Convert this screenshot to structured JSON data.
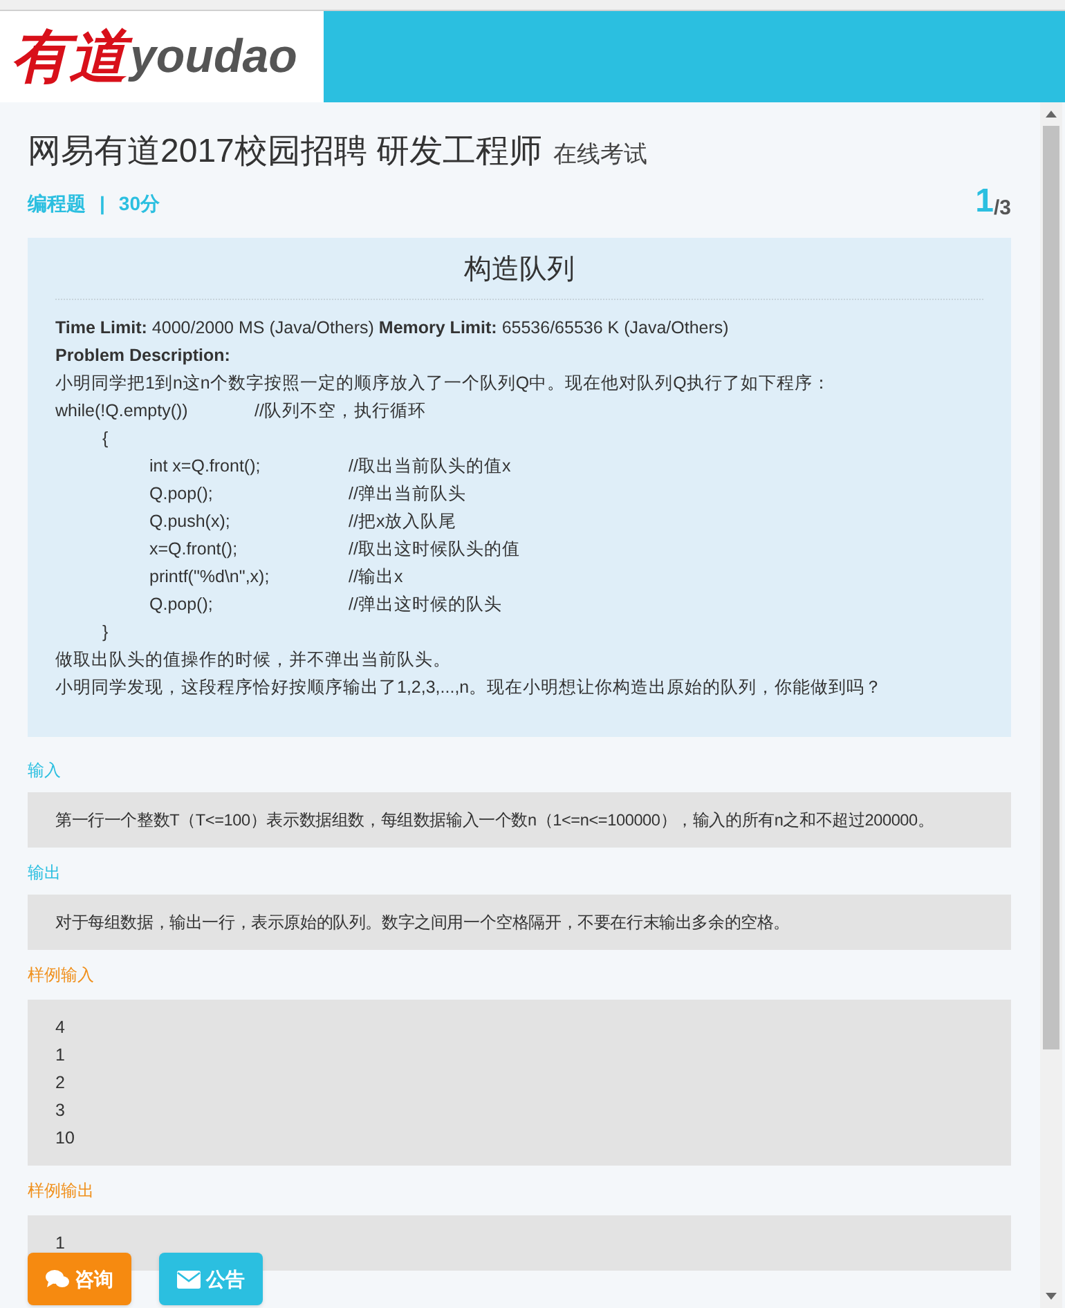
{
  "header": {
    "logo_cn": "有道",
    "logo_en": "youdao"
  },
  "exam": {
    "title": "网易有道2017校园招聘 研发工程师",
    "subtitle": "在线考试",
    "type": "编程题",
    "separator": "|",
    "score": "30分",
    "current": "1",
    "total": "/3"
  },
  "problem": {
    "title": "构造队列",
    "limits": "**Time Limit:** 4000/2000 MS (Java/Others) **Memory Limit:** 65536/65536 K (Java/Others)",
    "description_label": "Problem Description:",
    "lines": [
      {
        "kind": "text",
        "text": "小明同学把1到n这n个数字按照一定的顺序放入了一个队列Q中。现在他对队列Q执行了如下程序："
      },
      {
        "kind": "code",
        "code": "while(!Q.empty())",
        "comment": "//队列不空，执行循环",
        "children": [
          {
            "kind": "code",
            "code": "{",
            "children": [
              {
                "kind": "code",
                "code": "int x=Q.front();",
                "comment": "//取出当前队头的值x"
              },
              {
                "kind": "code",
                "code": "Q.pop();",
                "comment": "//弹出当前队头"
              },
              {
                "kind": "code",
                "code": "Q.push(x);",
                "comment": "//把x放入队尾"
              },
              {
                "kind": "code",
                "code": "x=Q.front();",
                "comment": "//取出这时候队头的值"
              },
              {
                "kind": "code",
                "code": "printf(\"%d\\n\",x);",
                "comment": "//输出x"
              },
              {
                "kind": "code",
                "code": "Q.pop();",
                "comment": "//弹出这时候的队头"
              }
            ]
          },
          {
            "kind": "code",
            "code": "}"
          }
        ]
      },
      {
        "kind": "text",
        "text": "做取出队头的值操作的时候，并不弹出当前队头。"
      },
      {
        "kind": "text",
        "text": "小明同学发现，这段程序恰好按顺序输出了1,2,3,...,n。现在小明想让你构造出原始的队列，你能做到吗？"
      }
    ]
  },
  "sections": [
    {
      "kind": "info",
      "label": "输入",
      "lines": [
        "第一行一个整数T（T<=100）表示数据组数，每组数据输入一个数n（1<=n<=100000），输入的所有n之和不超过200000。"
      ]
    },
    {
      "kind": "info",
      "label": "输出",
      "lines": [
        "对于每组数据，输出一行，表示原始的队列。数字之间用一个空格隔开，不要在行末输出多余的空格。"
      ]
    },
    {
      "kind": "sample",
      "label": "样例输入",
      "lines": [
        "4",
        "1",
        "2",
        "3",
        "10"
      ]
    },
    {
      "kind": "sample",
      "label": "样例输出",
      "lines": [
        "1"
      ]
    }
  ],
  "buttons": [
    {
      "kind": "consult",
      "label": "咨询"
    },
    {
      "kind": "notice",
      "label": "公告"
    }
  ]
}
